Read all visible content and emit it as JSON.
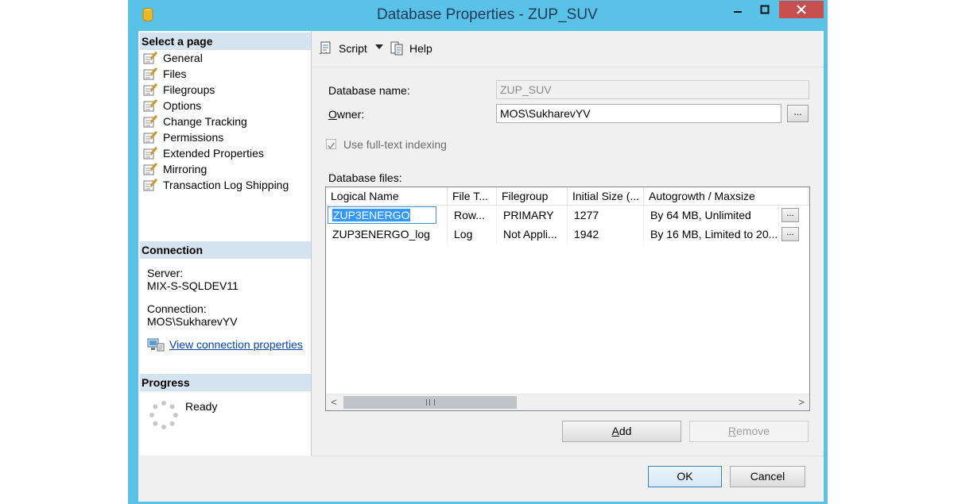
{
  "window": {
    "title": "Database Properties - ZUP_SUV",
    "controls": {
      "minimize": "—",
      "maximize": "□",
      "close": "✕"
    },
    "close_color": "#c7504f",
    "frame_color": "#5bc2e7"
  },
  "left_pane": {
    "select_page_title": "Select a page",
    "pages": [
      {
        "label": "General"
      },
      {
        "label": "Files"
      },
      {
        "label": "Filegroups"
      },
      {
        "label": "Options"
      },
      {
        "label": "Change Tracking"
      },
      {
        "label": "Permissions"
      },
      {
        "label": "Extended Properties"
      },
      {
        "label": "Mirroring"
      },
      {
        "label": "Transaction Log Shipping"
      }
    ],
    "connection_title": "Connection",
    "server_label": "Server:",
    "server_value": "MIX-S-SQLDEV11",
    "connection_label": "Connection:",
    "connection_value": "MOS\\SukharevYV",
    "view_connection_link": "View connection properties",
    "progress_title": "Progress",
    "progress_status": "Ready"
  },
  "toolbar": {
    "script_label": "Script",
    "help_label": "Help"
  },
  "form": {
    "database_name_label": "Database name:",
    "database_name_value": "ZUP_SUV",
    "owner_label": "Owner:",
    "owner_value": "MOS\\SukharevYV",
    "browse_label": "...",
    "fulltext_label": "Use full-text indexing",
    "fulltext_checked": true,
    "database_files_label": "Database files:"
  },
  "files_grid": {
    "columns": [
      "Logical Name",
      "File T...",
      "Filegroup",
      "Initial Size (...",
      "Autogrowth / Maxsize"
    ],
    "rows": [
      {
        "logical_name": "ZUP3ENERGO",
        "file_type": "Row...",
        "filegroup": "PRIMARY",
        "initial_size": "1277",
        "autogrowth": "By 64 MB, Unlimited",
        "button": "..."
      },
      {
        "logical_name": "ZUP3ENERGO_log",
        "file_type": "Log",
        "filegroup": "Not Appli...",
        "initial_size": "1942",
        "autogrowth": "By 16 MB, Limited to 20...",
        "button": "..."
      }
    ],
    "scroll_left": "<",
    "scroll_right": ">"
  },
  "buttons": {
    "add": "Add",
    "remove": "Remove",
    "ok": "OK",
    "cancel": "Cancel"
  },
  "colors": {
    "section_header": "#d5e3ee",
    "selection": "#3399ff",
    "link": "#0645ad"
  }
}
